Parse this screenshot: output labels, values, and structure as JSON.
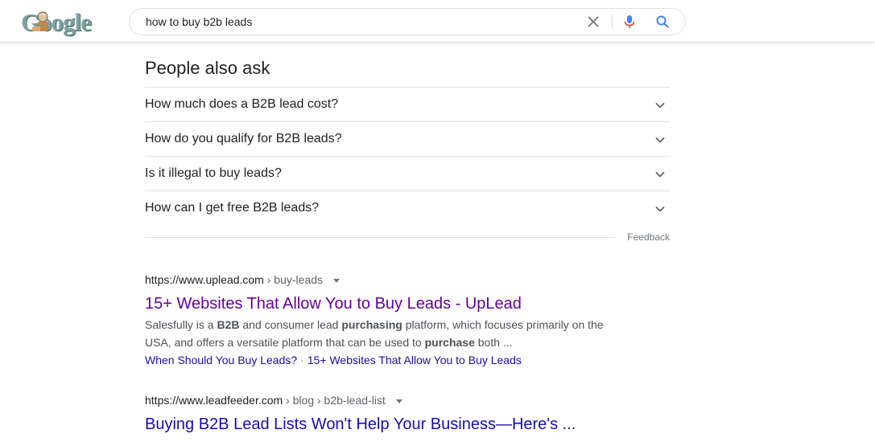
{
  "header": {
    "logo_text": "Google",
    "search": {
      "value": "how to buy b2b leads"
    },
    "icons": {
      "clear": "close-icon",
      "mic": "microphone-icon",
      "search": "search-icon"
    }
  },
  "paa": {
    "title": "People also ask",
    "questions": [
      "How much does a B2B lead cost?",
      "How do you qualify for B2B leads?",
      "Is it illegal to buy leads?",
      "How can I get free B2B leads?"
    ],
    "feedback": "Feedback"
  },
  "results": [
    {
      "domain": "https://www.uplead.com",
      "path": " › buy-leads",
      "title": "15+ Websites That Allow You to Buy Leads - UpLead",
      "snippet": [
        {
          "t": "Salesfully is a ",
          "b": false
        },
        {
          "t": "B2B",
          "b": true
        },
        {
          "t": " and consumer lead ",
          "b": false
        },
        {
          "t": "purchasing",
          "b": true
        },
        {
          "t": " platform, which focuses primarily on the USA, and offers a versatile platform that can be used to ",
          "b": false
        },
        {
          "t": "purchase",
          "b": true
        },
        {
          "t": " both ...",
          "b": false
        }
      ],
      "sitelinks": [
        "When Should You Buy Leads?",
        "15+ Websites That Allow You to Buy Leads"
      ],
      "sitelink_separator": "·"
    },
    {
      "domain": "https://www.leadfeeder.com",
      "path": " › blog › b2b-lead-list",
      "title": "Buying B2B Lead Lists Won't Help Your Business—Here's ..."
    }
  ],
  "colors": {
    "visited_link": "#660099",
    "link": "#1a0dab",
    "text": "#202124",
    "snippet": "#4d5156",
    "mic_blue": "#4285f4",
    "mic_red": "#ea4335"
  }
}
